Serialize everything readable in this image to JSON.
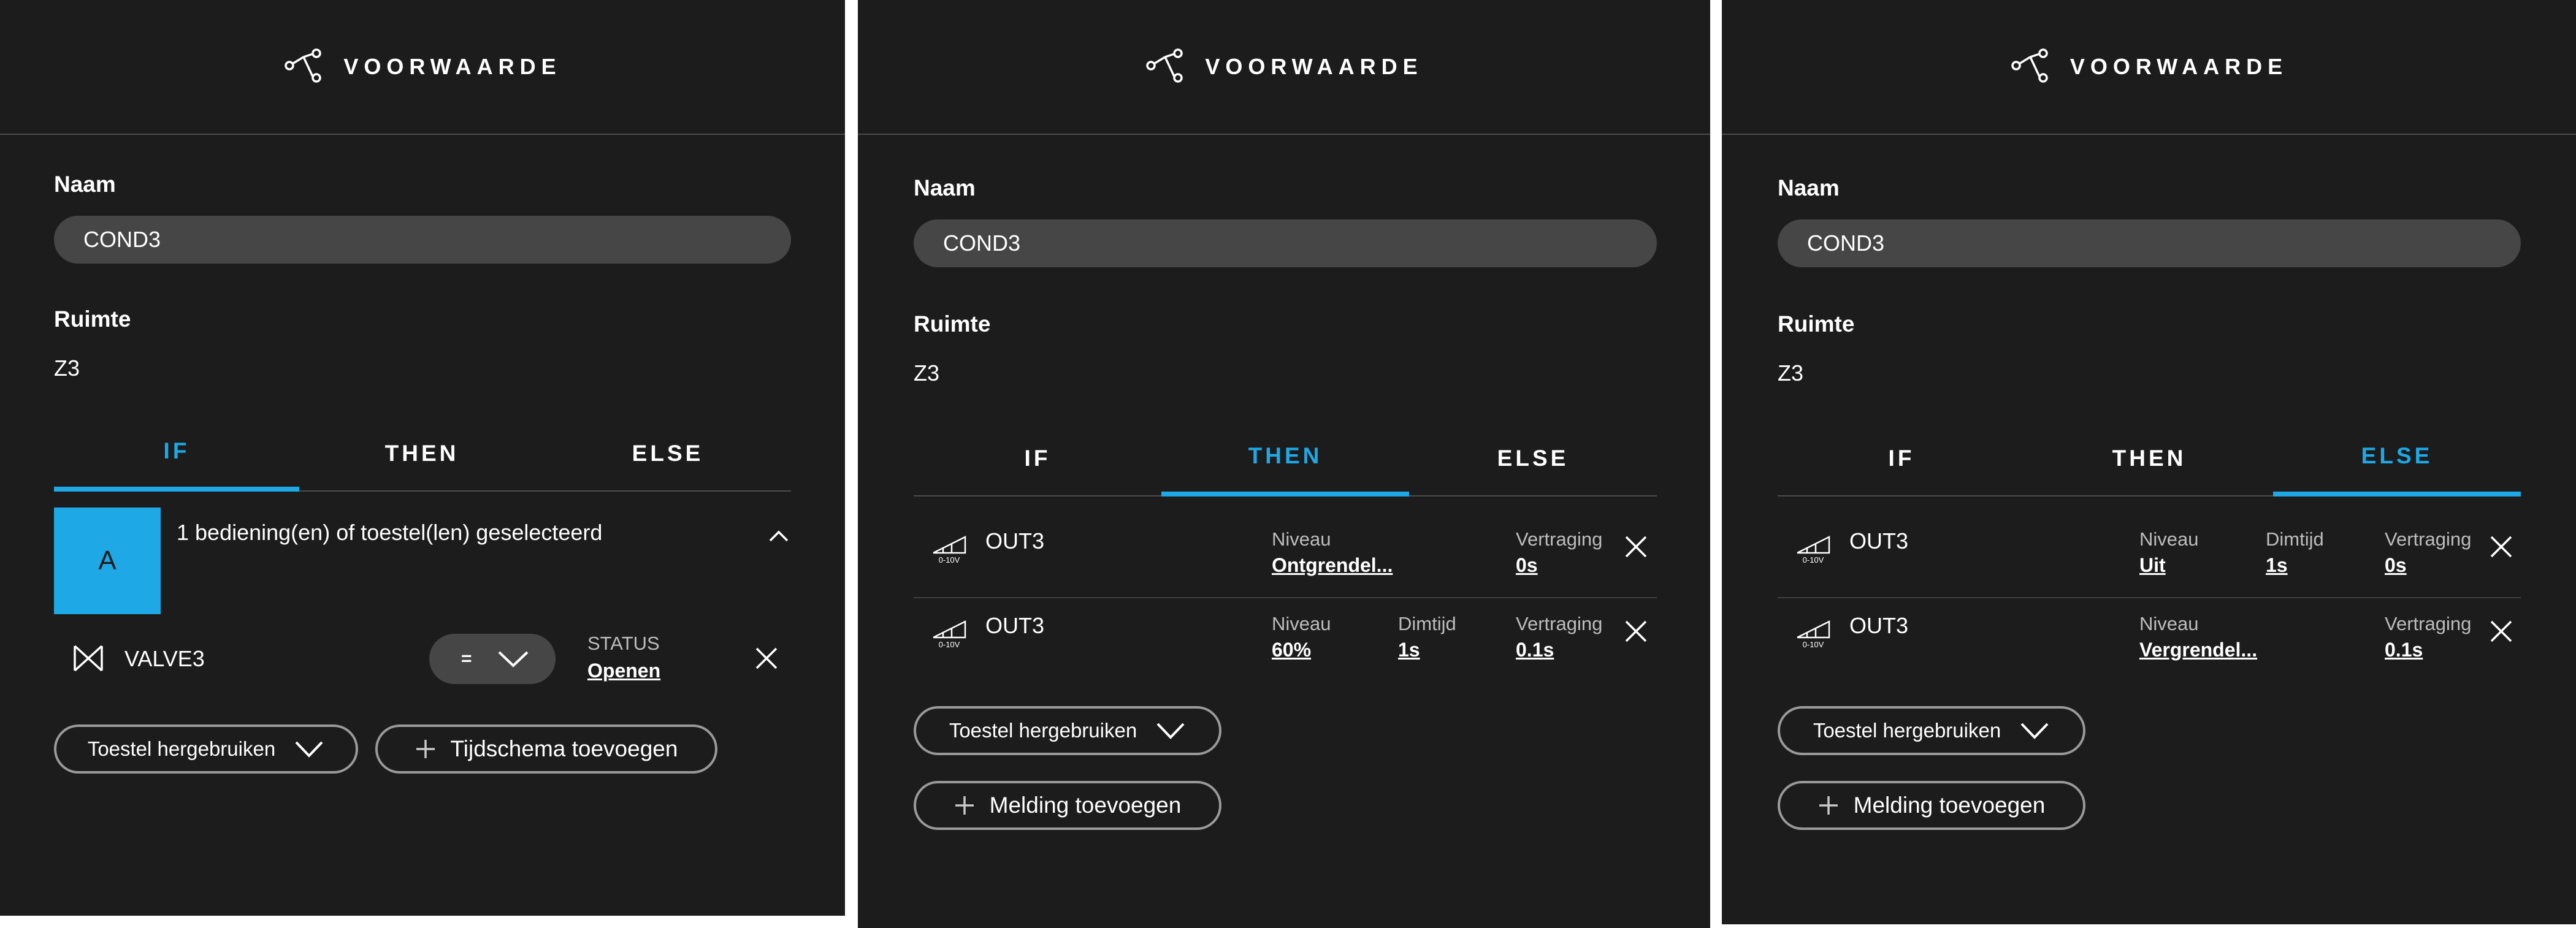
{
  "header": {
    "title": "VOORWAARDE",
    "icon": "share-nodes-icon"
  },
  "form": {
    "name_label": "Naam",
    "name_value": "COND3",
    "room_label": "Ruimte",
    "room_value": "Z3"
  },
  "tabs": {
    "if": "IF",
    "then": "THEN",
    "else": "ELSE"
  },
  "colors": {
    "accent": "#1ea8e6",
    "panel_bg": "#1c1c1c",
    "input_bg": "#464646"
  },
  "panels": [
    {
      "active_tab": "IF",
      "condition": {
        "avatar_letter": "A",
        "summary": "1 bediening(en) of toestel(len) geselecteerd",
        "device_icon": "valve-icon",
        "device_name": "VALVE3",
        "operator": "=",
        "status_label": "STATUS",
        "status_value": "Openen"
      },
      "buttons": {
        "reuse": "Toestel hergebruiken",
        "add": "Tijdschema toevoegen"
      }
    },
    {
      "active_tab": "THEN",
      "actions": [
        {
          "icon": "dimmer-0-10v-icon",
          "icon_text": "0-10V",
          "name": "OUT3",
          "level_label": "Niveau",
          "level_value": "Ontgrendel...",
          "delay_label": "Vertraging",
          "delay_value": "0s"
        },
        {
          "icon": "dimmer-0-10v-icon",
          "icon_text": "0-10V",
          "name": "OUT3",
          "level_label": "Niveau",
          "level_value": "60%",
          "dim_label": "Dimtijd",
          "dim_value": "1s",
          "delay_label": "Vertraging",
          "delay_value": "0.1s"
        }
      ],
      "buttons": {
        "reuse": "Toestel hergebruiken",
        "add": "Melding toevoegen"
      }
    },
    {
      "active_tab": "ELSE",
      "actions": [
        {
          "icon": "dimmer-0-10v-icon",
          "icon_text": "0-10V",
          "name": "OUT3",
          "level_label": "Niveau",
          "level_value": "Uit",
          "dim_label": "Dimtijd",
          "dim_value": "1s",
          "delay_label": "Vertraging",
          "delay_value": "0s"
        },
        {
          "icon": "dimmer-0-10v-icon",
          "icon_text": "0-10V",
          "name": "OUT3",
          "level_label": "Niveau",
          "level_value": "Vergrendel...",
          "delay_label": "Vertraging",
          "delay_value": "0.1s"
        }
      ],
      "buttons": {
        "reuse": "Toestel hergebruiken",
        "add": "Melding toevoegen"
      }
    }
  ]
}
